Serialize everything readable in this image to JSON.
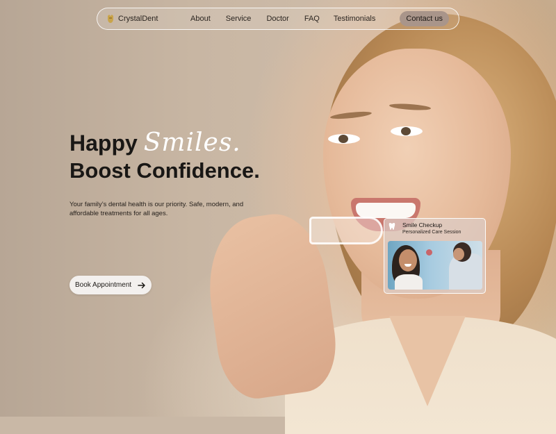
{
  "nav": {
    "brand": "CrystalDent",
    "logo_icon": "crown-tooth-icon",
    "links": [
      "About",
      "Service",
      "Doctor",
      "FAQ",
      "Testimonials"
    ],
    "cta": "Contact us"
  },
  "hero": {
    "title_part1": "Happy ",
    "title_script": "Smiles.",
    "title_line2": "Boost Confidence.",
    "subtitle": "Your family’s dental health is our priority. Safe, modern, and affordable treatments for all ages.",
    "cta": "Book Appointment",
    "cta_icon": "arrow-right-icon"
  },
  "card": {
    "icon": "tooth-icon",
    "title": "Smile Checkup",
    "subtitle": "Personalized Care Session"
  },
  "colors": {
    "text_dark": "#191715",
    "accent_script": "#ffffff",
    "cta_background": "#a9958a",
    "button_background": "#f3f0ee"
  }
}
